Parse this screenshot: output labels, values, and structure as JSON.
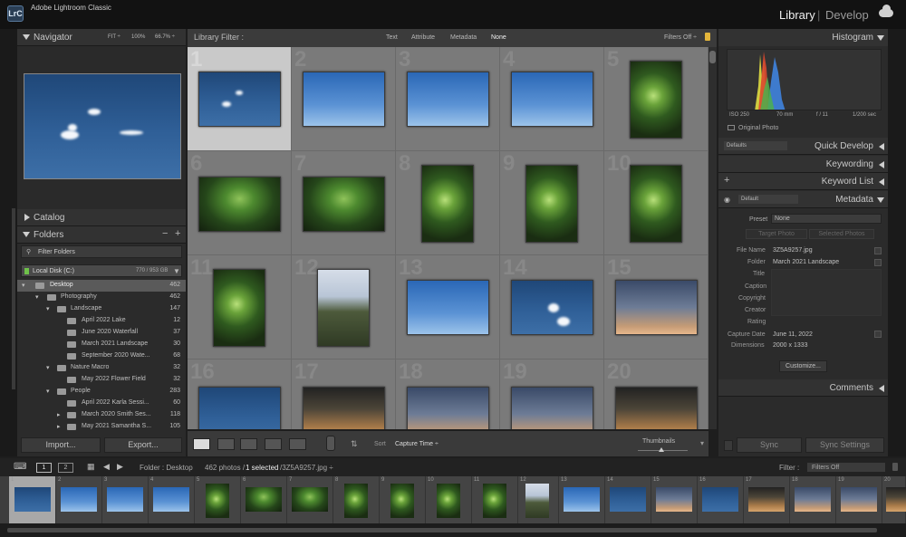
{
  "app": {
    "title": "Adobe Lightroom Classic",
    "logo": "LrC"
  },
  "modules": {
    "library": "Library",
    "separator": "|",
    "develop": "Develop"
  },
  "navigator": {
    "title": "Navigator",
    "fit": "FIT ÷",
    "z100": "100%",
    "z66": "66.7% ÷"
  },
  "catalog": {
    "title": "Catalog"
  },
  "folders": {
    "title": "Folders",
    "minus": "−",
    "plus": "+",
    "filter_placeholder": "Filter Folders",
    "disk": "Local Disk (C:)",
    "disk_space": "770 / 953 GB",
    "tree": [
      {
        "name": "Desktop",
        "count": "462"
      },
      {
        "name": "Photography",
        "count": "462"
      },
      {
        "name": "Landscape",
        "count": "147"
      },
      {
        "name": "April 2022 Lake",
        "count": "12"
      },
      {
        "name": "June 2020 Waterfall",
        "count": "37"
      },
      {
        "name": "March 2021 Landscape",
        "count": "30"
      },
      {
        "name": "September 2020 Wate...",
        "count": "68"
      },
      {
        "name": "Nature Macro",
        "count": "32"
      },
      {
        "name": "May 2022 Flower Field",
        "count": "32"
      },
      {
        "name": "People",
        "count": "283"
      },
      {
        "name": "April 2022 Karla Sessi...",
        "count": "60"
      },
      {
        "name": "March 2020 Smith Ses...",
        "count": "118"
      },
      {
        "name": "May 2021 Samantha S...",
        "count": "105"
      }
    ]
  },
  "left_buttons": {
    "import": "Import...",
    "export": "Export..."
  },
  "library_filter": {
    "label": "Library Filter :",
    "text": "Text",
    "attribute": "Attribute",
    "metadata": "Metadata",
    "none": "None",
    "filters_off": "Filters Off ÷"
  },
  "grid_numbers": [
    "1",
    "2",
    "3",
    "4",
    "5",
    "6",
    "7",
    "8",
    "9",
    "10",
    "11",
    "12",
    "13",
    "14",
    "15",
    "16",
    "17",
    "18",
    "19",
    "20"
  ],
  "toolbar": {
    "sort_label": "Sort",
    "sort_value": "Capture Time ÷",
    "thumbnails": "Thumbnails"
  },
  "histogram": {
    "title": "Histogram",
    "iso": "ISO 250",
    "focal": "70 mm",
    "aperture": "f / 11",
    "shutter": "1/200 sec",
    "original_photo": "Original Photo"
  },
  "quick_develop": {
    "title": "Quick Develop",
    "preset": "Defaults"
  },
  "keywording": {
    "title": "Keywording"
  },
  "keyword_list": {
    "title": "Keyword List",
    "plus": "+"
  },
  "metadata": {
    "title": "Metadata",
    "preset_select": "Default",
    "preset_label": "Preset",
    "preset_value": "None",
    "target_photo": "Target Photo",
    "selected_photos": "Selected Photos",
    "fields": [
      {
        "label": "File Name",
        "value": "3Z5A9257.jpg"
      },
      {
        "label": "Folder",
        "value": "March 2021 Landscape"
      },
      {
        "label": "Title",
        "value": ""
      },
      {
        "label": "Caption",
        "value": ""
      },
      {
        "label": "Copyright",
        "value": ""
      },
      {
        "label": "Creator",
        "value": ""
      },
      {
        "label": "Rating",
        "value": ""
      },
      {
        "label": "Capture Date",
        "value": "June 11, 2022"
      },
      {
        "label": "Dimensions",
        "value": "2000 x 1333"
      }
    ],
    "customize": "Customize..."
  },
  "comments": {
    "title": "Comments"
  },
  "sync": {
    "sync": "Sync",
    "sync_settings": "Sync Settings"
  },
  "filmstrip_bar": {
    "screen1": "1",
    "screen2": "2",
    "source": "Folder : Desktop",
    "count": "462 photos /",
    "selected": "1 selected",
    "file": "/3Z5A9257.jpg ÷",
    "filter_label": "Filter :",
    "filter_value": "Filters Off"
  },
  "filmstrip_numbers": [
    "1",
    "2",
    "3",
    "4",
    "5",
    "6",
    "7",
    "8",
    "9",
    "10",
    "11",
    "12",
    "13",
    "14",
    "15",
    "16",
    "17",
    "18",
    "19",
    "20"
  ],
  "colors": {
    "accent": "#d7d7d7",
    "panel": "#2b2b2b",
    "grid_bg": "#7a7a7a",
    "selected_cell": "#c9c9c9"
  },
  "icons": {
    "filmstrip_left": "arrow-left-icon",
    "filmstrip_right": "arrow-right-icon",
    "grid": "grid-icon",
    "cloud": "cloud-icon"
  }
}
